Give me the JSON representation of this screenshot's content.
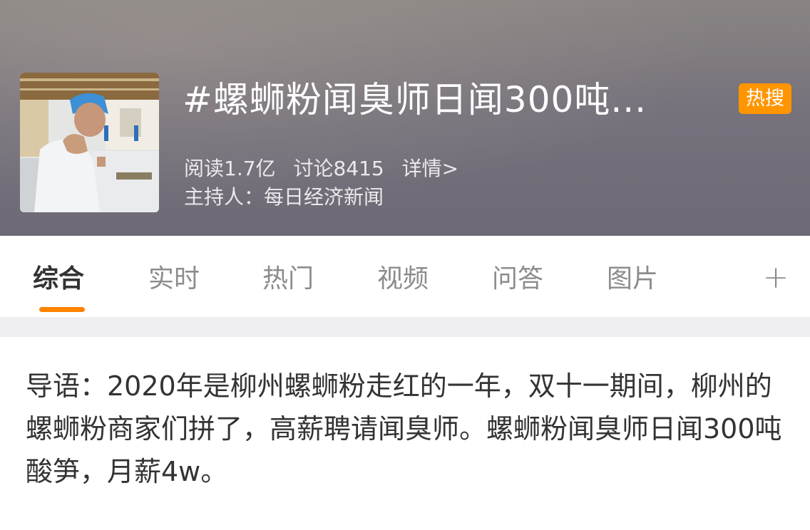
{
  "header": {
    "title": "#螺蛳粉闻臭师日闻300吨...",
    "badge": "热搜",
    "stats": {
      "reads": "阅读1.7亿",
      "discussion": "讨论8415",
      "details": "详情>"
    },
    "host": "主持人：每日经济新闻"
  },
  "tabs": {
    "items": [
      {
        "label": "综合"
      },
      {
        "label": "实时"
      },
      {
        "label": "热门"
      },
      {
        "label": "视频"
      },
      {
        "label": "问答"
      },
      {
        "label": "图片"
      }
    ],
    "add_icon": "plus-icon",
    "add_label": "+"
  },
  "intro": {
    "text": "导语：2020年是柳州螺蛳粉走红的一年，双十一期间，柳州的螺蛳粉商家们拼了，高薪聘请闻臭师。螺蛳粉闻臭师日闻300吨酸笋，月薪4w。"
  },
  "colors": {
    "accent": "#ff8200",
    "badge": "#ff9500",
    "separator": "#efeff2"
  }
}
